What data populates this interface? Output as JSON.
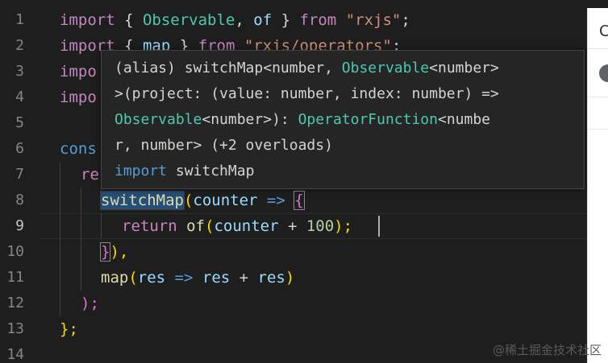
{
  "editor": {
    "line_numbers": [
      "1",
      "2",
      "3",
      "4",
      "5",
      "6",
      "7",
      "8",
      "9",
      "10",
      "11",
      "12",
      "13",
      "14"
    ],
    "line1": {
      "import": "import",
      "b1": " { ",
      "obs": "Observable",
      "comma": ", ",
      "of": "of",
      "b2": " } ",
      "from": "from",
      "sp": " ",
      "mod": "\"rxjs\"",
      "semi": ";"
    },
    "line2": {
      "import": "import",
      "b1": " { ",
      "map": "map",
      "b2": " } ",
      "from": "from",
      "sp": " ",
      "mod": "\"rxjs/operators\"",
      "semi": ";"
    },
    "line3": {
      "import": "impo"
    },
    "line4": {
      "import": "impo"
    },
    "line6": {
      "const": "cons"
    },
    "line7": {
      "ret": "re"
    },
    "line8": {
      "fn": "switchMap",
      "open": "(",
      "param": "counter",
      "arrow": " => ",
      "brace": "{"
    },
    "line9": {
      "ret": "return",
      "sp": " ",
      "of": "of",
      "open": "(",
      "var": "counter",
      "plus": " + ",
      "num": "100",
      "close": ");"
    },
    "line10": {
      "brace": "}",
      "close": "),"
    },
    "line11": {
      "fn": "map",
      "open": "(",
      "res1": "res",
      "arrow": " => ",
      "res2": "res",
      "plus": " + ",
      "res3": "res",
      "close": ")"
    },
    "line12": {
      "close": ");"
    },
    "line13": {
      "close": "};"
    }
  },
  "tooltip": {
    "l1_a": "(alias) switchMap<number, ",
    "l1_obs": "Observable",
    "l1_b": "<number>",
    "l2": ">(project: (value: number, index: number) =>",
    "l3_obs": "Observable",
    "l3_a": "<number>): ",
    "l3_op": "OperatorFunction",
    "l3_b": "<numbe",
    "l4": "r, number> (+2 overloads)",
    "l5_kw": "import",
    "l5_name": " switchMap"
  },
  "right_panel": {
    "tab_label": "C"
  },
  "watermark": "@稀土掘金技术社区",
  "colors": {
    "background": "#1e1e1e",
    "keyword": "#569cd6",
    "control": "#c586c0",
    "string": "#ce9178",
    "type": "#4ec9b0",
    "function": "#dcdcaa",
    "variable": "#9cdcfe",
    "number": "#b5cea8"
  }
}
